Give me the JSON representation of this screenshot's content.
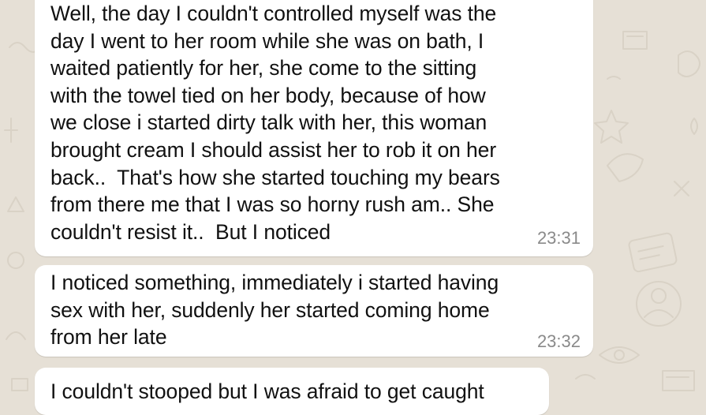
{
  "theme": {
    "chat_background": "#e6e0d6",
    "bubble_color": "#ffffff",
    "text_color": "#111111",
    "timestamp_color": "#8a8a8a"
  },
  "messages": [
    {
      "text": "Well, the day I couldn't controlled myself was the\nday I went to her room while she was on bath, I\nwaited patiently for her, she come to the sitting\nwith the towel tied on her body, because of how\nwe close i started dirty talk with her, this woman\nbrought cream I should assist her to rob it on her\nback..  That's how she started touching my bears\nfrom there me that I was so horny rush am.. She\ncouldn't resist it..  But I noticed",
      "time": "23:31"
    },
    {
      "text": "I noticed something, immediately i started having\nsex with her, suddenly her started coming home\nfrom her late",
      "time": "23:32"
    },
    {
      "text": "I couldn't stooped but I was afraid to get caught",
      "time": ""
    }
  ]
}
